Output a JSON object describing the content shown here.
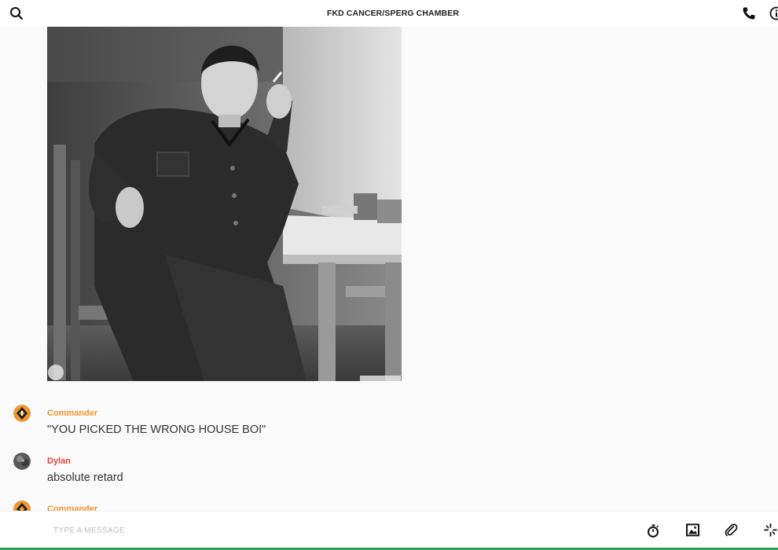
{
  "header": {
    "title": "FKD CANCER/SPERG CHAMBER",
    "icons": [
      "search-icon",
      "phone-icon",
      "info-icon"
    ]
  },
  "messages": [
    {
      "sender": "Commander",
      "sender_color": "#f0962d",
      "avatar": "commander-avatar",
      "text": "\"YOU PICKED THE WRONG HOUSE BOI\""
    },
    {
      "sender": "Dylan",
      "sender_color": "#e0473e",
      "avatar": "dylan-avatar",
      "text": "absolute retard"
    },
    {
      "sender": "Commander",
      "sender_color": "#f0962d",
      "avatar": "commander-avatar",
      "text": ""
    }
  ],
  "composer": {
    "placeholder": "TYPE A MESSAGE",
    "value": "",
    "icons": [
      "timer-icon",
      "image-icon",
      "attachment-icon",
      "sparkle-icon"
    ]
  },
  "colors": {
    "accent_orange": "#f0962d",
    "accent_red": "#e0473e",
    "bottom_bar": "#2f9e4f"
  }
}
